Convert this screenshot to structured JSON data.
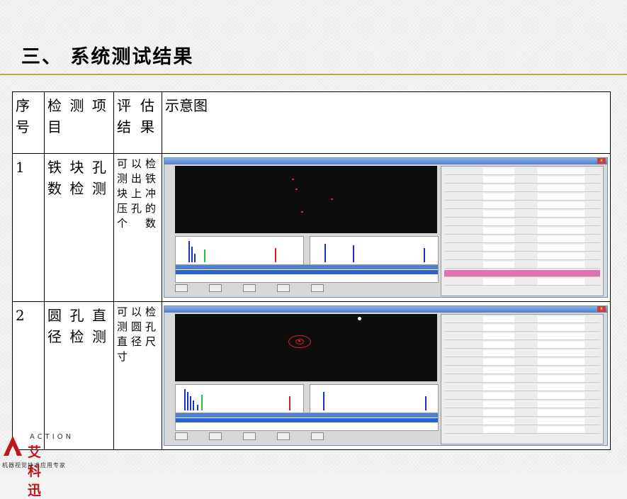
{
  "title": "三、 系统测试结果",
  "table": {
    "headers": {
      "no": "序号",
      "item": "检测项目",
      "eval": "评估结果",
      "diagram": "示意图"
    },
    "rows": [
      {
        "no": "1",
        "item": "铁块孔数检测",
        "eval": "可以检测出铁块上冲压孔的个数"
      },
      {
        "no": "2",
        "item": "圆孔直径检测",
        "eval": "可以检测圆孔直径尺寸"
      }
    ]
  },
  "logo": {
    "brand": "ACTION",
    "name": "艾科迅",
    "tagline": "机器视觉技术应用专家",
    "color": "#c01818"
  }
}
